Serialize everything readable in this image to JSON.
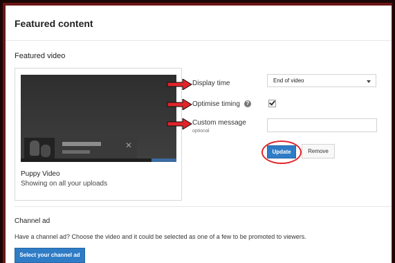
{
  "header": {
    "title": "Featured content"
  },
  "featured_video": {
    "section_title": "Featured video",
    "video_title": "Puppy Video",
    "video_subtitle": "Showing on all your uploads"
  },
  "settings": {
    "display_time_label": "Display time",
    "display_time_value": "End of video",
    "optimise_timing_label": "Optimise timing",
    "optimise_timing_checked": true,
    "custom_message_label": "Custom message",
    "custom_message_sublabel": "optional",
    "custom_message_value": ""
  },
  "buttons": {
    "update": "Update",
    "remove": "Remove"
  },
  "channel_ad": {
    "section_title": "Channel ad",
    "description": "Have a channel ad? Choose the video and it could be selected as one of a few to be promoted to viewers.",
    "button": "Select your channel ad"
  },
  "icons": {
    "help": "?",
    "close": "✕",
    "arrow": "red-arrow-pointer-icon",
    "check": "checkmark-icon"
  },
  "colors": {
    "accent_blue": "#2f7cc6",
    "annotation_red": "#e0242a",
    "frame_dark_red": "#6b1616"
  }
}
